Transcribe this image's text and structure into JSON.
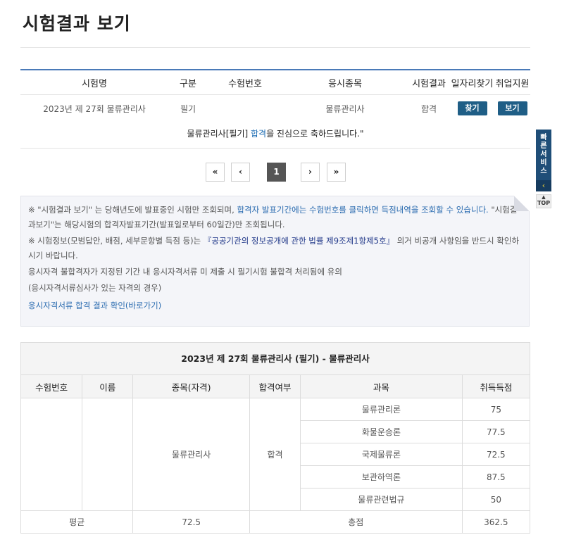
{
  "page": {
    "title": "시험결과 보기"
  },
  "result_table": {
    "headers": [
      "시험명",
      "구분",
      "수험번호",
      "응시종목",
      "시험결과",
      "일자리찾기",
      "취업지원"
    ],
    "row": {
      "exam_name": "2023년 제 27회 물류관리사",
      "type": "필기",
      "exam_number": "",
      "subject": "물류관리사",
      "result": "합격",
      "job_search_button": "찾기",
      "employment_button": "보기"
    },
    "congrats_prefix": "물류관리사[필기] ",
    "congrats_highlight": "합격",
    "congrats_suffix": "을 진심으로 축하드립니다.\""
  },
  "pagination": {
    "first": "«",
    "prev": "‹",
    "current": "1",
    "next": "›",
    "last": "»"
  },
  "notice": {
    "line1_a": "※ \"시험결과 보기\" 는 당해년도에 발표중인 시험만 조회되며, ",
    "line1_b": "합격자 발표기간에는 수험번호를 클릭하면 득점내역을 조회할 수 있습니다.",
    "line1_c": " \"시험결과보기\"는 해당시험의 합격자발표기간(발표일로부터 60일간)만 조회됩니다.",
    "line2_a": "※ 시험정보(모범답안, 배점, 세부문항별 득점 등)는 ",
    "line2_b": "『공공기관의 정보공개에 관한 법률 제9조제1항제5호』",
    "line2_c": " 의거 비공개 사항임을 반드시 확인하시기 바랍니다.",
    "line3": "응시자격 불합격자가 지정된 기간 내 응시자격서류 미 제출 시 필기시험 불합격 처리됨에 유의",
    "line4": "(응시자격서류심사가 있는 자격의 경우)",
    "link": "응시자격서류 합격 결과 확인(바로가기)"
  },
  "score_table": {
    "title": "2023년 제 27회 물류관리사 (필기) - 물류관리사",
    "headers": [
      "수험번호",
      "이름",
      "종목(자격)",
      "합격여부",
      "과목",
      "취득득점"
    ],
    "exam_number": "",
    "name": "",
    "qualification": "물류관리사",
    "pass": "합격",
    "subjects": [
      {
        "name": "물류관리론",
        "score": "75"
      },
      {
        "name": "화물운송론",
        "score": "77.5"
      },
      {
        "name": "국제물류론",
        "score": "72.5"
      },
      {
        "name": "보관하역론",
        "score": "87.5"
      },
      {
        "name": "물류관련법규",
        "score": "50"
      }
    ],
    "average_label": "평균",
    "average_value": "72.5",
    "total_label": "총점",
    "total_value": "362.5"
  },
  "quick_service": {
    "label": "빠른서비스",
    "arrow": "‹",
    "top": "TOP"
  }
}
